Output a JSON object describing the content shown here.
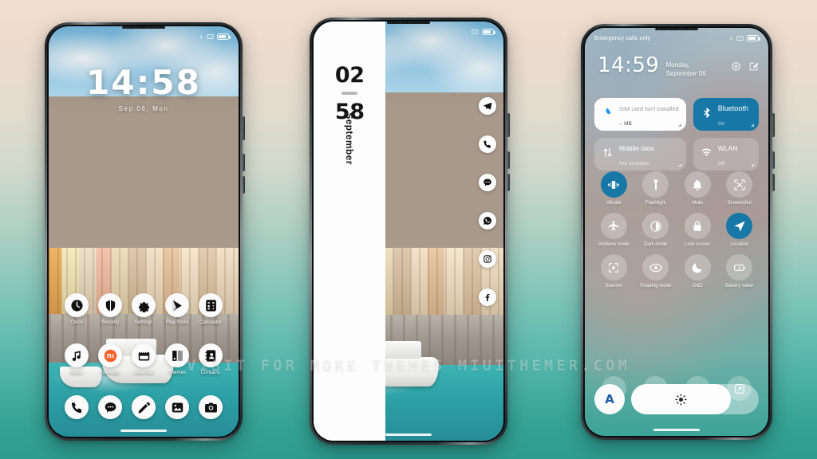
{
  "watermark": "VISIT FOR MORE THEMES MIUITHEMER.COM",
  "background": {
    "top_color": "#f0ddcd",
    "bottom_color": "#2d9c90"
  },
  "phone1": {
    "name": "lockscreen-home",
    "statusbar": {
      "left": "",
      "bluetooth": "bluetooth-icon",
      "alarm": "alarm-icon",
      "battery": "battery-icon"
    },
    "clock": {
      "time": "14:58",
      "date": "Sep 06, Mon"
    },
    "apps_row1": [
      {
        "label": "Clock",
        "icon": "clock-icon"
      },
      {
        "label": "Security",
        "icon": "shield-icon"
      },
      {
        "label": "Settings",
        "icon": "gear-icon"
      },
      {
        "label": "Play Store",
        "icon": "play-store-icon"
      },
      {
        "label": "Calculator",
        "icon": "calculator-icon"
      }
    ],
    "apps_row2": [
      {
        "label": "Music",
        "icon": "music-note-icon"
      },
      {
        "label": "GetApps",
        "icon": "mi-getapps-icon"
      },
      {
        "label": "Calendar",
        "icon": "calendar-icon"
      },
      {
        "label": "Themes",
        "icon": "themes-icon"
      },
      {
        "label": "Contacts",
        "icon": "contacts-icon"
      }
    ],
    "dock": [
      {
        "label": "Phone",
        "icon": "phone-icon"
      },
      {
        "label": "Messages",
        "icon": "message-icon"
      },
      {
        "label": "Notes",
        "icon": "pencil-icon"
      },
      {
        "label": "Gallery",
        "icon": "gallery-icon"
      },
      {
        "label": "Camera",
        "icon": "camera-icon"
      }
    ]
  },
  "phone2": {
    "name": "always-on-display",
    "statusbar": {
      "alarm": "alarm-icon",
      "battery": "battery-icon"
    },
    "aod": {
      "hours": "02",
      "minutes": "58",
      "month": "September"
    },
    "side_apps": [
      {
        "label": "Telegram",
        "icon": "telegram-icon"
      },
      {
        "label": "Phone",
        "icon": "phone-icon"
      },
      {
        "label": "Messages",
        "icon": "message-icon"
      },
      {
        "label": "WhatsApp",
        "icon": "whatsapp-icon"
      },
      {
        "label": "Instagram",
        "icon": "instagram-icon"
      },
      {
        "label": "Facebook",
        "icon": "facebook-icon"
      }
    ]
  },
  "phone3": {
    "name": "notification-shade",
    "statusbar": {
      "carrier": "Emergency calls only",
      "bluetooth": "bluetooth-icon",
      "alarm": "alarm-icon",
      "battery": "battery-icon"
    },
    "clock": {
      "time": "14:59",
      "date": "Monday, September 06"
    },
    "header_actions": [
      {
        "name": "settings-gear",
        "icon": "gear-hex-icon"
      },
      {
        "name": "edit-tiles",
        "icon": "edit-icon"
      }
    ],
    "big_tiles": [
      {
        "label": "SIM card isn't installed",
        "sub": "-- MB",
        "state": "light",
        "icon": "data-drop-icon"
      },
      {
        "label": "Bluetooth",
        "sub": "On",
        "state": "on",
        "icon": "bluetooth-icon"
      },
      {
        "label": "Mobile data",
        "sub": "Not available",
        "state": "off",
        "icon": "mobile-data-icon"
      },
      {
        "label": "WLAN",
        "sub": "Off",
        "state": "off",
        "icon": "wifi-icon"
      }
    ],
    "tiles": [
      {
        "label": "Vibrate",
        "icon": "vibrate-icon",
        "active": true
      },
      {
        "label": "Flashlight",
        "icon": "flashlight-icon",
        "active": false
      },
      {
        "label": "Mute",
        "icon": "bell-icon",
        "active": false
      },
      {
        "label": "Screenshot",
        "icon": "screenshot-icon",
        "active": false
      },
      {
        "label": "Airplane mode",
        "icon": "airplane-icon",
        "active": false
      },
      {
        "label": "Dark mode",
        "icon": "contrast-icon",
        "active": false
      },
      {
        "label": "Lock screen",
        "icon": "lock-icon",
        "active": false
      },
      {
        "label": "Location",
        "icon": "location-icon",
        "active": true
      },
      {
        "label": "Scanner",
        "icon": "scanner-icon",
        "active": false
      },
      {
        "label": "Reading mode",
        "icon": "eye-icon",
        "active": false
      },
      {
        "label": "DND",
        "icon": "moon-icon",
        "active": false
      },
      {
        "label": "Battery saver",
        "icon": "battery-saver-icon",
        "active": false
      }
    ],
    "tiles_small": [
      {
        "label": "",
        "icon": "lightning-icon"
      },
      {
        "label": "",
        "icon": "cast-icon"
      },
      {
        "label": "",
        "icon": "video-toolbox-icon"
      },
      {
        "label": "",
        "icon": "rotate-icon"
      }
    ],
    "brightness": {
      "auto_label": "A",
      "value_percent": 78,
      "icon": "brightness-icon"
    }
  },
  "colors": {
    "accent_blue": "#1778a8",
    "tile_off": "rgba(255,255,255,0.20)",
    "white": "#fdfdfd"
  }
}
